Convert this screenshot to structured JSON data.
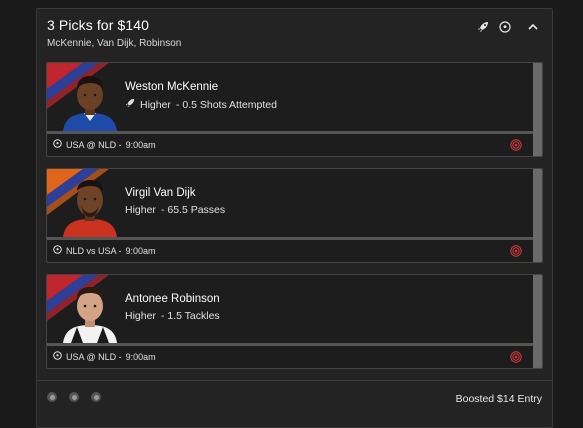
{
  "header": {
    "title": "3 Picks for $140",
    "players_summary": "McKennie, Van Dijk, Robinson"
  },
  "icons": {
    "rocket": "rocket-icon",
    "soccer": "soccer-ball-icon",
    "collapse": "chevron-up-icon",
    "target": "target-icon"
  },
  "cards": [
    {
      "name": "Weston McKennie",
      "direction": "Higher",
      "line": "- 0.5 Shots Attempted",
      "boosted": true,
      "matchup": "USA @ NLD -",
      "time": "9:00am",
      "jersey_color": "#1e4aa8"
    },
    {
      "name": "Virgil Van Dijk",
      "direction": "Higher",
      "line": "- 65.5 Passes",
      "boosted": false,
      "matchup": "NLD vs USA -",
      "time": "9:00am",
      "jersey_color": "#c8321e"
    },
    {
      "name": "Antonee Robinson",
      "direction": "Higher",
      "line": "- 1.5 Tackles",
      "boosted": false,
      "matchup": "USA @ NLD -",
      "time": "9:00am",
      "jersey_color": "#f2f2f2"
    }
  ],
  "footer": {
    "entry_label": "Boosted $14 Entry"
  },
  "colors": {
    "stripe_red": "#c0262d",
    "stripe_blue": "#2e3f9a",
    "target_red": "#e0353a",
    "accent_bg": "#232323"
  }
}
